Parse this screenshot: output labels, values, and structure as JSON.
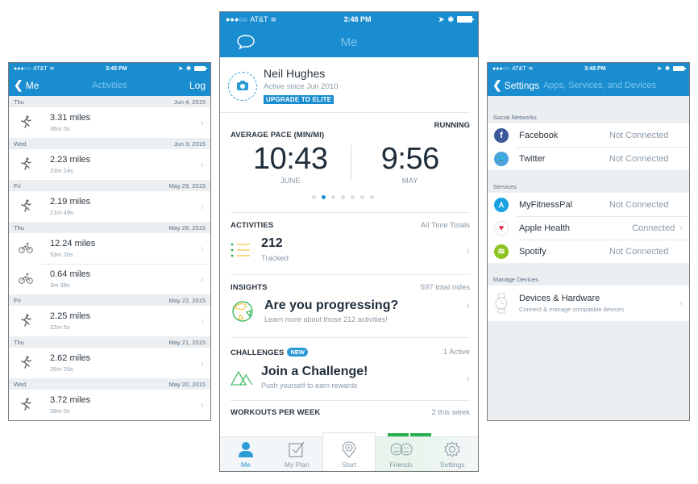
{
  "left_phone": {
    "status_bar": {
      "carrier": "AT&T",
      "time": "3:45 PM"
    },
    "nav": {
      "back_label": "Me",
      "title": "Activities",
      "action_label": "Log"
    },
    "days": [
      {
        "weekday": "Thu",
        "date": "Jun 4, 2015",
        "activities": [
          {
            "type": "run",
            "distance": "3.31 miles",
            "duration": "36m 0s"
          }
        ]
      },
      {
        "weekday": "Wed",
        "date": "Jun 3, 2015",
        "activities": [
          {
            "type": "run",
            "distance": "2.23 miles",
            "duration": "23m 24s"
          }
        ]
      },
      {
        "weekday": "Fri",
        "date": "May 29, 2015",
        "activities": [
          {
            "type": "run",
            "distance": "2.19 miles",
            "duration": "21m 49s"
          }
        ]
      },
      {
        "weekday": "Thu",
        "date": "May 28, 2015",
        "activities": [
          {
            "type": "bike",
            "distance": "12.24 miles",
            "duration": "53m 26s"
          },
          {
            "type": "bike",
            "distance": "0.64 miles",
            "duration": "3m 39s"
          }
        ]
      },
      {
        "weekday": "Fri",
        "date": "May 22, 2015",
        "activities": [
          {
            "type": "run",
            "distance": "2.25 miles",
            "duration": "22m 5s"
          }
        ]
      },
      {
        "weekday": "Thu",
        "date": "May 21, 2015",
        "activities": [
          {
            "type": "run",
            "distance": "2.62 miles",
            "duration": "26m 26s"
          }
        ]
      },
      {
        "weekday": "Wed",
        "date": "May 20, 2015",
        "activities": [
          {
            "type": "run",
            "distance": "3.72 miles",
            "duration": "38m 0s"
          }
        ]
      }
    ]
  },
  "center_phone": {
    "status_bar": {
      "carrier": "AT&T",
      "time": "3:48 PM"
    },
    "nav": {
      "title": "Me",
      "left_icon": "chat-bubble-icon"
    },
    "profile": {
      "name": "Neil Hughes",
      "since": "Active since Jun 2010",
      "badge": "UPGRADE TO ELITE"
    },
    "pace": {
      "title": "AVERAGE PACE (MIN/MI)",
      "sport": "RUNNING",
      "current": {
        "value": "10:43",
        "label": "JUNE"
      },
      "previous": {
        "value": "9:56",
        "label": "MAY"
      },
      "page_count": 7,
      "active_page": 1
    },
    "activities": {
      "title": "ACTIVITIES",
      "aside": "All Time Totals",
      "count": "212",
      "sub": "Tracked"
    },
    "insights": {
      "title": "INSIGHTS",
      "aside": "597 total miles",
      "heading": "Are you progressing?",
      "sub": "Learn more about those 212 activities!"
    },
    "challenges": {
      "title": "CHALLENGES",
      "badge": "NEW",
      "aside": "1 Active",
      "heading": "Join a Challenge!",
      "sub": "Push yourself to earn rewards"
    },
    "workouts": {
      "title": "WORKOUTS PER WEEK",
      "aside": "2 this week"
    },
    "tabs": [
      {
        "label": "Me",
        "icon": "person-icon",
        "active": true
      },
      {
        "label": "My Plan",
        "icon": "checkbox-icon"
      },
      {
        "label": "Start",
        "icon": "location-pin-icon"
      },
      {
        "label": "Friends",
        "icon": "smiley-faces-icon"
      },
      {
        "label": "Settings",
        "icon": "gear-icon"
      }
    ],
    "colors": {
      "primary": "#1a8dd0",
      "green": "#27b04d"
    }
  },
  "right_phone": {
    "status_bar": {
      "carrier": "AT&T",
      "time": "3:48 PM"
    },
    "nav": {
      "back_label": "Settings",
      "title": "Apps, Services, and Devices"
    },
    "social": {
      "label": "Social Networks",
      "items": [
        {
          "name": "Facebook",
          "status": "Not Connected",
          "icon": "facebook-icon",
          "color": "#3b5998"
        },
        {
          "name": "Twitter",
          "status": "Not Connected",
          "icon": "twitter-icon",
          "color": "#4aa3df"
        }
      ]
    },
    "services": {
      "label": "Services",
      "items": [
        {
          "name": "MyFitnessPal",
          "status": "Not Connected",
          "icon": "myfitnesspal-icon",
          "color": "#1ba0e1"
        },
        {
          "name": "Apple Health",
          "status": "Connected",
          "icon": "heart-icon",
          "color": "#e0344f"
        },
        {
          "name": "Spotify",
          "status": "Not Connected",
          "icon": "spotify-icon",
          "color": "#8dc21f"
        }
      ]
    },
    "devices": {
      "label": "Manage Devices",
      "name": "Devices & Hardware",
      "sub": "Connect & manage compatible devices"
    }
  }
}
